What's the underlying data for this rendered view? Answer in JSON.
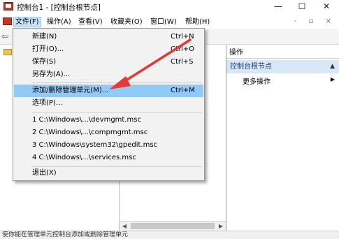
{
  "window": {
    "title": "控制台1 - [控制台根节点]",
    "minimize_glyph": "—",
    "maximize_glyph": "☐",
    "close_glyph": "✕"
  },
  "menubar": {
    "items": [
      "文件(F)",
      "操作(A)",
      "查看(V)",
      "收藏夹(O)",
      "窗口(W)",
      "帮助(H)"
    ],
    "active": "文件(F)",
    "mdi_controls": "- ▫ ×"
  },
  "file_menu": {
    "items": [
      {
        "label": "新建(N)",
        "shortcut": "Ctrl+N"
      },
      {
        "label": "打开(O)...",
        "shortcut": "Ctrl+O"
      },
      {
        "label": "保存(S)",
        "shortcut": "Ctrl+S"
      },
      {
        "label": "另存为(A)...",
        "shortcut": ""
      },
      {
        "label": "添加/删除管理单元(M)...",
        "shortcut": "Ctrl+M",
        "highlighted": true
      },
      {
        "label": "选项(P)...",
        "shortcut": ""
      },
      {
        "label": "1 C:\\Windows\\...\\devmgmt.msc",
        "shortcut": ""
      },
      {
        "label": "2 C:\\Windows\\...\\compmgmt.msc",
        "shortcut": ""
      },
      {
        "label": "3 C:\\Windows\\system32\\gpedit.msc",
        "shortcut": ""
      },
      {
        "label": "4 C:\\Windows\\...\\services.msc",
        "shortcut": ""
      },
      {
        "label": "退出(X)",
        "shortcut": ""
      }
    ]
  },
  "action_pane": {
    "header": "操作",
    "section": "控制台根节点",
    "more_actions": "更多操作"
  },
  "statusbar": {
    "text": "使你能在管理单元控制台添加或删除管理单元"
  },
  "colors": {
    "menu_highlight": "#91c9f7",
    "annotation_arrow": "#e53935",
    "action_section_bg": "#d9e6f5"
  }
}
